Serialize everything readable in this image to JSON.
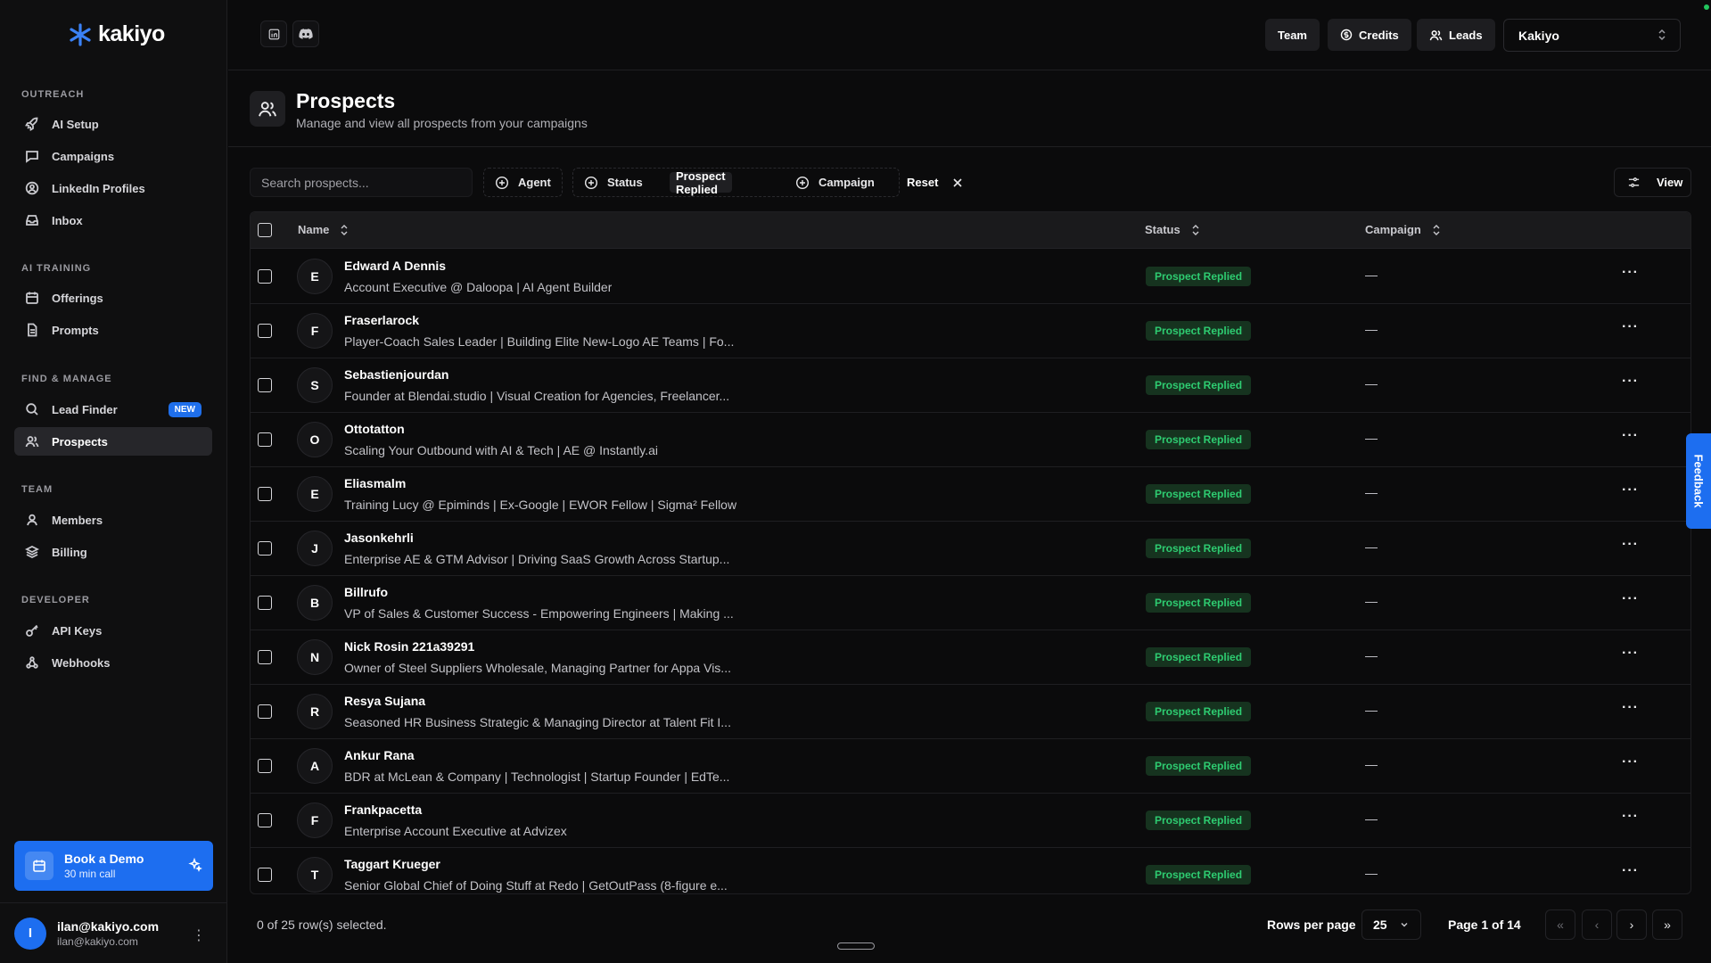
{
  "app": {
    "logo_text": "kakiyo"
  },
  "sidebar": {
    "sections": [
      {
        "title": "OUTREACH",
        "items": [
          "AI Setup",
          "Campaigns",
          "LinkedIn Profiles",
          "Inbox"
        ]
      },
      {
        "title": "AI TRAINING",
        "items": [
          "Offerings",
          "Prompts"
        ]
      },
      {
        "title": "FIND & MANAGE",
        "items": [
          "Lead Finder",
          "Prospects"
        ]
      },
      {
        "title": "TEAM",
        "items": [
          "Members",
          "Billing"
        ]
      },
      {
        "title": "DEVELOPER",
        "items": [
          "API Keys",
          "Webhooks"
        ]
      }
    ],
    "new_badge": "NEW",
    "demo": {
      "title": "Book a Demo",
      "subtitle": "30 min call"
    },
    "user": {
      "initial": "I",
      "name": "ilan@kakiyo.com",
      "email": "ilan@kakiyo.com"
    }
  },
  "topbar": {
    "team": "Team",
    "credits": "Credits",
    "leads": "Leads",
    "workspace": "Kakiyo"
  },
  "page": {
    "title": "Prospects",
    "subtitle": "Manage and view all prospects from your campaigns"
  },
  "toolbar": {
    "search_placeholder": "Search prospects...",
    "filter_agent": "Agent",
    "filter_status": "Status",
    "status_chip": "Prospect Replied",
    "filter_campaign": "Campaign",
    "reset": "Reset",
    "view": "View"
  },
  "table": {
    "columns": [
      "Name",
      "Status",
      "Campaign"
    ],
    "rows": [
      {
        "initial": "E",
        "name": "Edward A Dennis",
        "headline": "Account Executive @ Daloopa | AI Agent Builder",
        "status": "Prospect Replied",
        "campaign": "—"
      },
      {
        "initial": "F",
        "name": "Fraserlarock",
        "headline": "Player-Coach Sales Leader | Building Elite New-Logo AE Teams | Fo...",
        "status": "Prospect Replied",
        "campaign": "—"
      },
      {
        "initial": "S",
        "name": "Sebastienjourdan",
        "headline": "Founder at Blendai.studio | Visual Creation for Agencies, Freelancer...",
        "status": "Prospect Replied",
        "campaign": "—"
      },
      {
        "initial": "O",
        "name": "Ottotatton",
        "headline": "Scaling Your Outbound with AI & Tech | AE @ Instantly.ai",
        "status": "Prospect Replied",
        "campaign": "—"
      },
      {
        "initial": "E",
        "name": "Eliasmalm",
        "headline": "Training Lucy @ Epiminds | Ex-Google | EWOR Fellow | Sigma² Fellow",
        "status": "Prospect Replied",
        "campaign": "—"
      },
      {
        "initial": "J",
        "name": "Jasonkehrli",
        "headline": "Enterprise AE & GTM Advisor | Driving SaaS Growth Across Startup...",
        "status": "Prospect Replied",
        "campaign": "—"
      },
      {
        "initial": "B",
        "name": "Billrufo",
        "headline": "VP of Sales & Customer Success - Empowering Engineers | Making ...",
        "status": "Prospect Replied",
        "campaign": "—"
      },
      {
        "initial": "N",
        "name": "Nick Rosin 221a39291",
        "headline": "Owner of Steel Suppliers Wholesale, Managing Partner for Appa Vis...",
        "status": "Prospect Replied",
        "campaign": "—"
      },
      {
        "initial": "R",
        "name": "Resya Sujana",
        "headline": "Seasoned HR Business Strategic & Managing Director at Talent Fit I...",
        "status": "Prospect Replied",
        "campaign": "—"
      },
      {
        "initial": "A",
        "name": "Ankur Rana",
        "headline": "BDR at McLean & Company | Technologist | Startup Founder | EdTe...",
        "status": "Prospect Replied",
        "campaign": "—"
      },
      {
        "initial": "F",
        "name": "Frankpacetta",
        "headline": "Enterprise Account Executive at Advizex",
        "status": "Prospect Replied",
        "campaign": "—"
      },
      {
        "initial": "T",
        "name": "Taggart Krueger",
        "headline": "Senior Global Chief of Doing Stuff at Redo | GetOutPass (8-figure e...",
        "status": "Prospect Replied",
        "campaign": "—"
      }
    ]
  },
  "footer": {
    "selection": "0 of 25 row(s) selected.",
    "rows_per_page_label": "Rows per page",
    "rows_per_page": "25",
    "page_info": "Page 1 of 14"
  },
  "feedback": "Feedback",
  "colors": {
    "accent": "#1d6ef0",
    "status_green": "#2ecc71",
    "background": "#0b0b0c"
  }
}
